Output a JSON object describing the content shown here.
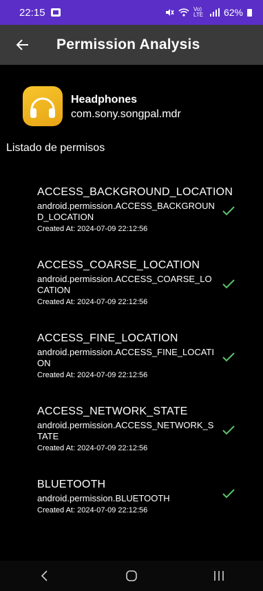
{
  "status_bar": {
    "time": "22:15",
    "signal_text": "Vo) LTE",
    "battery_text": "62%"
  },
  "app_bar": {
    "title": "Permission Analysis"
  },
  "app": {
    "name": "Headphones",
    "package": "com.sony.songpal.mdr",
    "icon_color": "#f0b51f"
  },
  "section_label": "Listado de permisos",
  "permissions": [
    {
      "name": "ACCESS_BACKGROUND_LOCATION",
      "id": "android.permission.ACCESS_BACKGROUND_LOCATION",
      "created": "Created At: 2024-07-09 22:12:56"
    },
    {
      "name": "ACCESS_COARSE_LOCATION",
      "id": "android.permission.ACCESS_COARSE_LOCATION",
      "created": "Created At: 2024-07-09 22:12:56"
    },
    {
      "name": "ACCESS_FINE_LOCATION",
      "id": "android.permission.ACCESS_FINE_LOCATION",
      "created": "Created At: 2024-07-09 22:12:56"
    },
    {
      "name": "ACCESS_NETWORK_STATE",
      "id": "android.permission.ACCESS_NETWORK_STATE",
      "created": "Created At: 2024-07-09 22:12:56"
    },
    {
      "name": "BLUETOOTH",
      "id": "android.permission.BLUETOOTH",
      "created": "Created At: 2024-07-09 22:12:56"
    }
  ],
  "colors": {
    "status_bar": "#5b2ec7",
    "app_bar": "#3a3a3a",
    "check": "#5cc46a",
    "background": "#000000"
  },
  "icons": {
    "back": "arrow-left-icon",
    "granted": "check-icon",
    "nav_back": "chevron-left-icon",
    "nav_home": "rounded-square-icon",
    "nav_recents": "three-bars-icon"
  }
}
